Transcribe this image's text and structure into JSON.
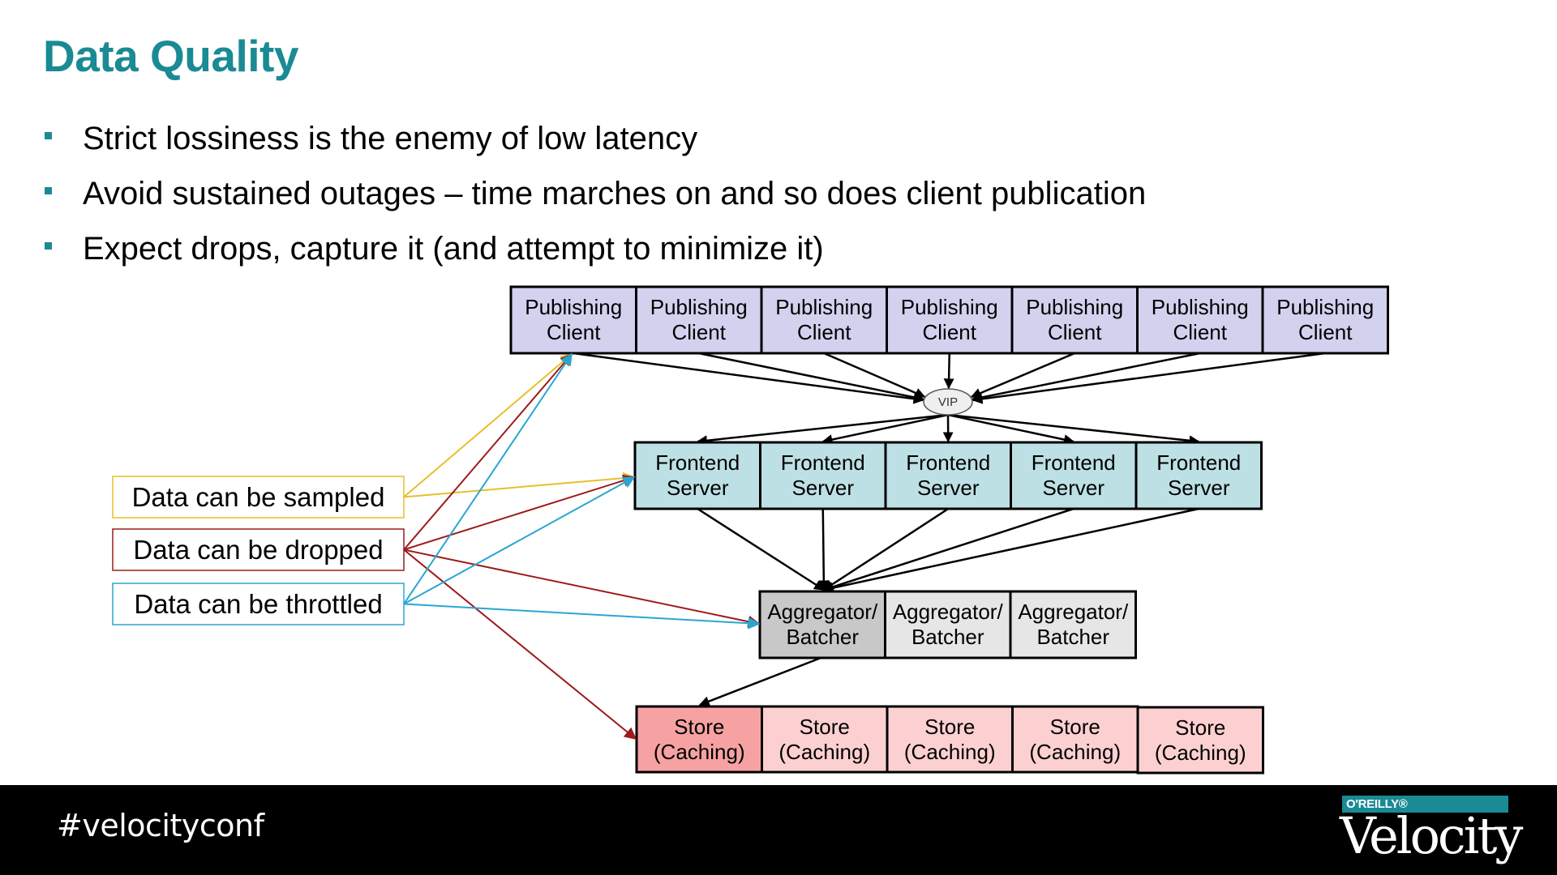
{
  "title": "Data Quality",
  "bullets": [
    "Strict lossiness is the enemy of low latency",
    "Avoid sustained outages – time marches on and so does client publication",
    "Expect drops, capture it (and attempt to minimize it)"
  ],
  "diagram": {
    "publishing_clients": {
      "count": 7,
      "line1": "Publishing",
      "line2": "Client",
      "fill": "#d2d2ef"
    },
    "vip": {
      "label": "VIP",
      "fill": "#efefef"
    },
    "frontend_servers": {
      "count": 5,
      "line1": "Frontend",
      "line2": "Server",
      "fill": "#bde0e4"
    },
    "aggregators": {
      "count": 3,
      "line1": "Aggregator/",
      "line2": "Batcher",
      "fill": "#e6e6e6",
      "highlight_fill": "#c8c8c8",
      "highlight_index": 0
    },
    "stores": {
      "count": 5,
      "line1": "Store",
      "line2": "(Caching)",
      "fill": "#fcd0d0",
      "highlight_fill": "#f6a2a2",
      "highlight_index": 0
    },
    "annotations": [
      {
        "id": "sampled",
        "label": "Data can be sampled",
        "color": "#e8bf2a",
        "targets": [
          "publishing",
          "frontend"
        ]
      },
      {
        "id": "dropped",
        "label": "Data can be dropped",
        "color": "#9e1a1a",
        "targets": [
          "publishing",
          "frontend",
          "aggregator",
          "store"
        ]
      },
      {
        "id": "throttled",
        "label": "Data can be throttled",
        "color": "#2aa6d2",
        "targets": [
          "publishing",
          "frontend",
          "aggregator"
        ]
      }
    ],
    "line_color": "#000000"
  },
  "footer": {
    "hashtag": "#velocityconf",
    "publisher": "O'REILLY®",
    "brand": "Velocity",
    "brand_color": "#1a8a94"
  }
}
